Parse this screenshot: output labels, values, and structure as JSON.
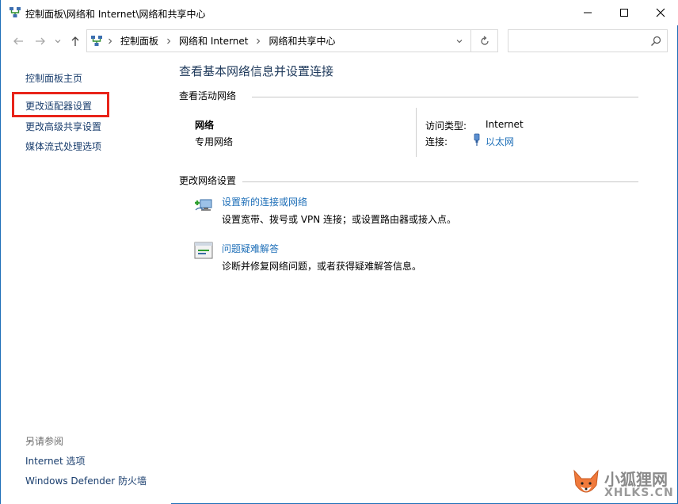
{
  "window": {
    "title": "控制面板\\网络和 Internet\\网络和共享中心",
    "icon": "network-center-icon"
  },
  "address": {
    "crumbs": [
      "控制面板",
      "网络和 Internet",
      "网络和共享中心"
    ],
    "search_placeholder": ""
  },
  "sidebar": {
    "home": "控制面板主页",
    "links": [
      "更改适配器设置",
      "更改高级共享设置",
      "媒体流式处理选项"
    ],
    "see_also_title": "另请参阅",
    "see_also": [
      "Internet 选项",
      "Windows Defender 防火墙"
    ]
  },
  "main": {
    "title": "查看基本网络信息并设置连接",
    "active_networks_label": "查看活动网络",
    "network": {
      "name": "网络",
      "profile": "专用网络",
      "access_type_label": "访问类型:",
      "access_type_value": "Internet",
      "connection_label": "连接:",
      "connection_value": "以太网"
    },
    "change_settings_label": "更改网络设置",
    "tasks": [
      {
        "link": "设置新的连接或网络",
        "desc": "设置宽带、拨号或 VPN 连接；或设置路由器或接入点。",
        "icon": "new-connection-icon"
      },
      {
        "link": "问题疑难解答",
        "desc": "诊断并修复网络问题，或者获得疑难解答信息。",
        "icon": "troubleshoot-icon"
      }
    ]
  },
  "watermark": {
    "title": "小狐狸网",
    "subtitle": "XHLKS.CN"
  },
  "colors": {
    "accent": "#1e6fb8",
    "title_blue": "#1e395b",
    "highlight": "#e8241a"
  }
}
